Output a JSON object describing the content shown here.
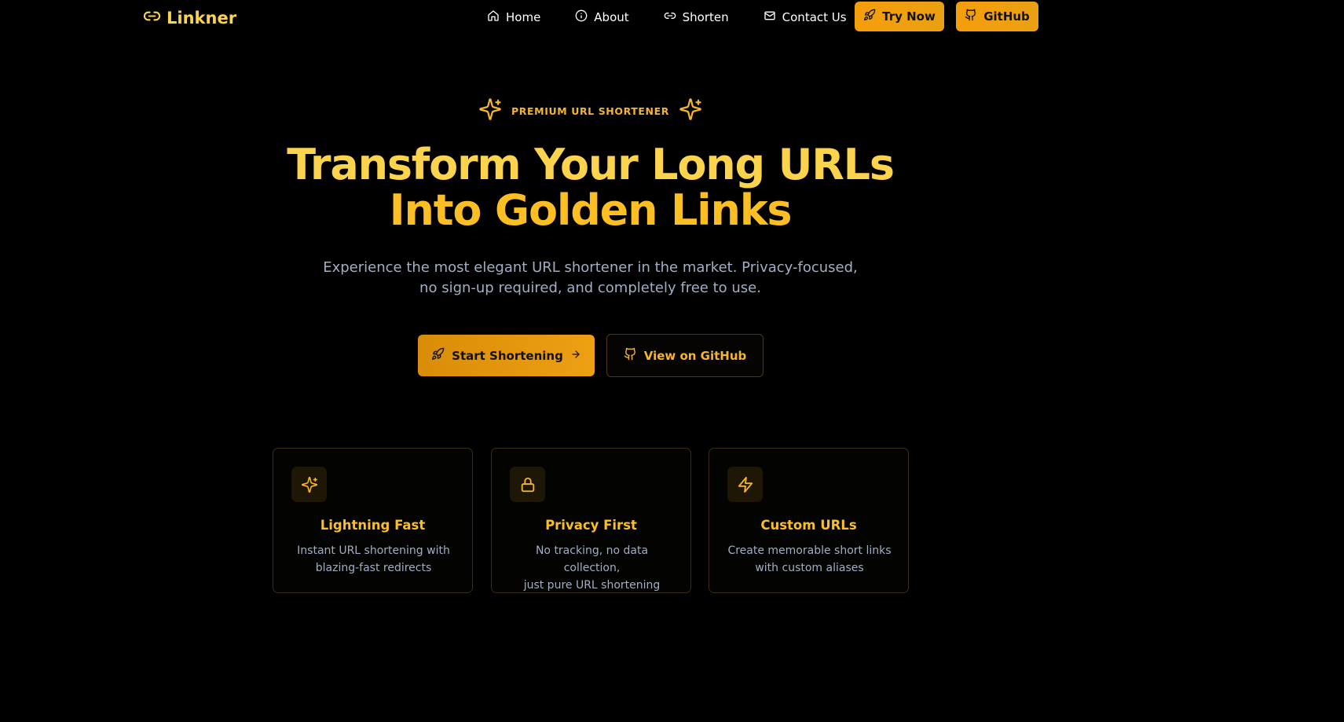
{
  "colors": {
    "background": "#000000",
    "accent": "#f59e0b",
    "headline": "#fcd34d",
    "muted": "#a3aec4"
  },
  "nav": {
    "logo": {
      "icon": "link-icon",
      "text": "Linkner"
    },
    "links": [
      {
        "icon": "home-icon",
        "label": "Home"
      },
      {
        "icon": "info-icon",
        "label": "About"
      },
      {
        "icon": "link-icon",
        "label": "Shorten"
      },
      {
        "icon": "mail-icon",
        "label": "Contact Us"
      }
    ],
    "try_now": {
      "icon": "rocket-icon",
      "label": "Try Now"
    },
    "github": {
      "icon": "github-icon",
      "label": "GitHub"
    }
  },
  "hero": {
    "badge": {
      "icon": "sparkles-icon",
      "text": "PREMIUM URL SHORTENER"
    },
    "headline_line1": "Transform Your Long URLs",
    "headline_line2": "Into Golden Links",
    "subtitle_line1": "Experience the most elegant URL shortener in the market. Privacy-focused,",
    "subtitle_line2": "no sign-up required, and completely free to use.",
    "start_button": {
      "icon": "rocket-icon",
      "label": "Start Shortening",
      "trailing_icon": "arrow-right-icon"
    },
    "github_button": {
      "icon": "github-icon",
      "label": "View on GitHub"
    }
  },
  "features": [
    {
      "icon": "sparkles-icon",
      "title": "Lightning Fast",
      "desc_line1": "Instant URL shortening with",
      "desc_line2": "blazing-fast redirects"
    },
    {
      "icon": "lock-icon",
      "title": "Privacy First",
      "desc_line1": "No tracking, no data collection,",
      "desc_line2": "just pure URL shortening"
    },
    {
      "icon": "zap-icon",
      "title": "Custom URLs",
      "desc_line1": "Create memorable short links",
      "desc_line2": "with custom aliases"
    }
  ]
}
